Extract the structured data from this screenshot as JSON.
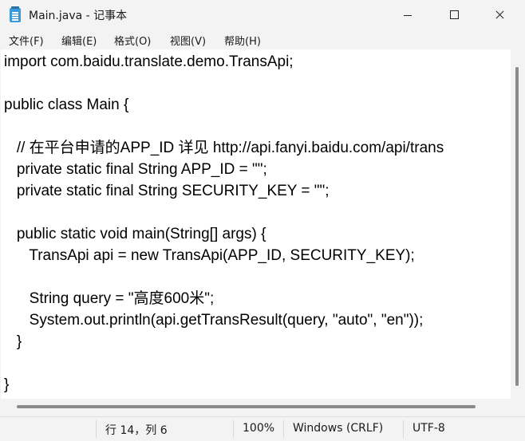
{
  "window": {
    "title": "Main.java - 记事本"
  },
  "menu": [
    {
      "label": "文件(F)"
    },
    {
      "label": "编辑(E)"
    },
    {
      "label": "格式(O)"
    },
    {
      "label": "视图(V)"
    },
    {
      "label": "帮助(H)"
    }
  ],
  "editor": {
    "lines": [
      "import com.baidu.translate.demo.TransApi;",
      "",
      "public class Main {",
      "",
      "   // 在平台申请的APP_ID 详见 http://api.fanyi.baidu.com/api/trans",
      "   private static final String APP_ID = \"\";",
      "   private static final String SECURITY_KEY = \"\";",
      "",
      "   public static void main(String[] args) {",
      "      TransApi api = new TransApi(APP_ID, SECURITY_KEY);",
      "",
      "      String query = \"高度600米\";",
      "      System.out.println(api.getTransResult(query, \"auto\", \"en\"));",
      "   }",
      "",
      "}"
    ]
  },
  "status": {
    "position": "行 14，列 6",
    "zoom": "100%",
    "line_ending": "Windows (CRLF)",
    "encoding": "UTF-8"
  }
}
